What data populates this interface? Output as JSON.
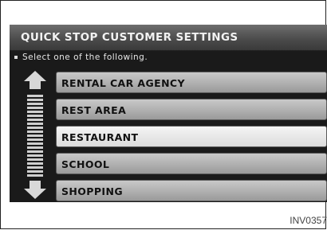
{
  "title": "QUICK STOP CUSTOMER SETTINGS",
  "instruction": "Select one of the following.",
  "items": [
    {
      "label": "RENTAL CAR AGENCY",
      "selected": false
    },
    {
      "label": "REST AREA",
      "selected": false
    },
    {
      "label": "RESTAURANT",
      "selected": true
    },
    {
      "label": "SCHOOL",
      "selected": false
    },
    {
      "label": "SHOPPING",
      "selected": false
    }
  ],
  "scroll": {
    "up_icon": "arrow-up-icon",
    "down_icon": "arrow-down-icon"
  },
  "caption": "INV0357"
}
